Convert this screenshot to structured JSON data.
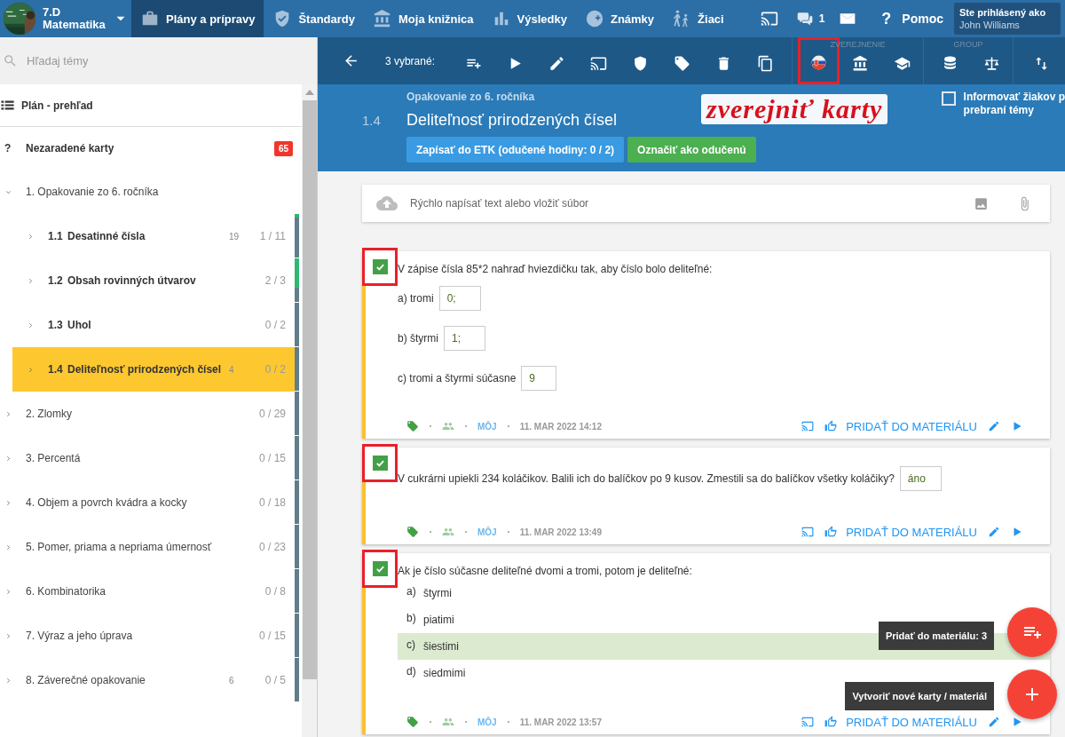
{
  "nav": {
    "class_name": "7.D",
    "subject": "Matematika",
    "tabs": [
      {
        "label": "Plány a prípravy",
        "selected": true
      },
      {
        "label": "Štandardy",
        "selected": false
      },
      {
        "label": "Moja knižnica",
        "selected": false
      },
      {
        "label": "Výsledky",
        "selected": false
      },
      {
        "label": "Známky",
        "selected": false
      },
      {
        "label": "Žiaci",
        "selected": false
      }
    ],
    "chat_count": "1",
    "help_glyph": "?",
    "help_label": "Pomoc",
    "user_caption": "Ste prihlásený ako",
    "user_name": "John Williams"
  },
  "sidebar": {
    "search_placeholder": "Hľadaj témy",
    "overview": "Plán - prehľad",
    "unsorted": {
      "glyph": "?",
      "label": "Nezaradené karty",
      "badge": "65"
    },
    "topics": [
      {
        "label": "1. Opakovanie zo 6. ročníka",
        "expanded": true,
        "selected": false,
        "children": [
          {
            "number": "1.1",
            "label": "Desatinné čísla",
            "count": "19",
            "progress": "1 / 11",
            "level": 0.09,
            "selected": false
          },
          {
            "number": "1.2",
            "label": "Obsah rovinných útvarov",
            "progress": "2 / 3",
            "level": 0.67,
            "selected": false
          },
          {
            "number": "1.3",
            "label": "Uhol",
            "progress": "0 / 2",
            "level": 0,
            "selected": false
          },
          {
            "number": "1.4",
            "label": "Deliteľnosť prirodzených čísel",
            "count": "4",
            "progress": "0 / 2",
            "level": 0,
            "selected": true
          }
        ]
      },
      {
        "label": "2. Zlomky",
        "expanded": false,
        "selected": false,
        "progress": "0 / 29"
      },
      {
        "label": "3. Percentá",
        "expanded": false,
        "selected": false,
        "progress": "0 / 15"
      },
      {
        "label": "4. Objem a povrch kvádra a kocky",
        "expanded": false,
        "selected": false,
        "progress": "0 / 18"
      },
      {
        "label": "5. Pomer, priama a nepriama úmernosť",
        "expanded": false,
        "selected": false,
        "progress": "0 / 23"
      },
      {
        "label": "6. Kombinatorika",
        "expanded": false,
        "selected": false,
        "progress": "0 / 8"
      },
      {
        "label": "7. Výraz a jeho úprava",
        "expanded": false,
        "selected": false,
        "progress": "0 / 15"
      },
      {
        "label": "8. Záverečné opakovanie",
        "expanded": false,
        "selected": false,
        "count": "6",
        "progress": "0 / 5"
      }
    ]
  },
  "toolbar": {
    "selection_label": "3 vybrané:",
    "sections": [
      {
        "buttons": [
          {
            "highlighted": false
          },
          {
            "highlighted": false
          },
          {
            "highlighted": false
          },
          {
            "highlighted": false
          },
          {
            "highlighted": false
          },
          {
            "highlighted": false
          },
          {
            "highlighted": false
          },
          {
            "highlighted": false
          }
        ]
      },
      {
        "label": "ZVEREJNENIE",
        "buttons": [
          {
            "highlighted": true
          },
          {
            "highlighted": false
          },
          {
            "highlighted": false
          }
        ]
      },
      {
        "label": "GROUP",
        "buttons": [
          {
            "highlighted": false
          },
          {
            "highlighted": false
          }
        ]
      },
      {
        "buttons": [
          {
            "highlighted": false
          }
        ]
      }
    ]
  },
  "header": {
    "chapter": "Opakovanie zo 6. ročníka",
    "number": "1.4",
    "title": "Deliteľnosť prirodzených čísel",
    "etk_button": "Zapísať do ETK (odučené hodiny: 0 / 2)",
    "done_button": "Označiť ako odučenú",
    "notify": {
      "checked": false,
      "lines": [
        "Informovať žiakov p",
        "prebraní témy"
      ]
    }
  },
  "annotation": {
    "text": "zverejniť karty"
  },
  "composer": {
    "placeholder": "Rýchlo napísať text alebo vložiť súbor"
  },
  "cards": [
    {
      "kind": "fill-in",
      "checked": true,
      "highlighted": true,
      "question": "V zápise čísla 85*2 nahraď hviezdičku tak, aby číslo bolo deliteľné:",
      "items": [
        {
          "label": "a) tromi",
          "answer": "0;"
        },
        {
          "label": "b) štyrmi",
          "answer": "1;"
        },
        {
          "label": "c) tromi a štyrmi súčasne",
          "answer": "9"
        }
      ],
      "footer": {
        "owner": "MÔJ",
        "date": "11. MAR 2022 14:12",
        "action": "PRIDAŤ DO MATERIÁLU"
      }
    },
    {
      "kind": "inline-answer",
      "checked": true,
      "highlighted": true,
      "question": "V cukrárni upiekli 234 koláčikov. Balili ich do balíčkov po 9 kusov. Zmestili sa do balíčkov všetky koláčiky?",
      "answer": "áno",
      "footer": {
        "owner": "MÔJ",
        "date": "11. MAR 2022 13:49",
        "action": "PRIDAŤ DO MATERIÁLU"
      }
    },
    {
      "kind": "choice",
      "checked": true,
      "highlighted": true,
      "question": "Ak je číslo súčasne deliteľné dvomi a tromi, potom je deliteľné:",
      "options": [
        {
          "letter": "a)",
          "label": "štyrmi",
          "selected": false
        },
        {
          "letter": "b)",
          "label": "piatimi",
          "selected": false
        },
        {
          "letter": "c)",
          "label": "šiestimi",
          "selected": true
        },
        {
          "letter": "d)",
          "label": "siedmimi",
          "selected": false
        }
      ],
      "footer": {
        "owner": "MÔJ",
        "date": "11. MAR 2022 13:57",
        "action": "PRIDAŤ DO MATERIÁLU"
      }
    }
  ],
  "fabs": [
    {
      "kind": "add",
      "tooltip": "Pridať do materiálu: 3"
    },
    {
      "kind": "create",
      "tooltip": "Vytvoriť nové karty / materiál"
    }
  ]
}
